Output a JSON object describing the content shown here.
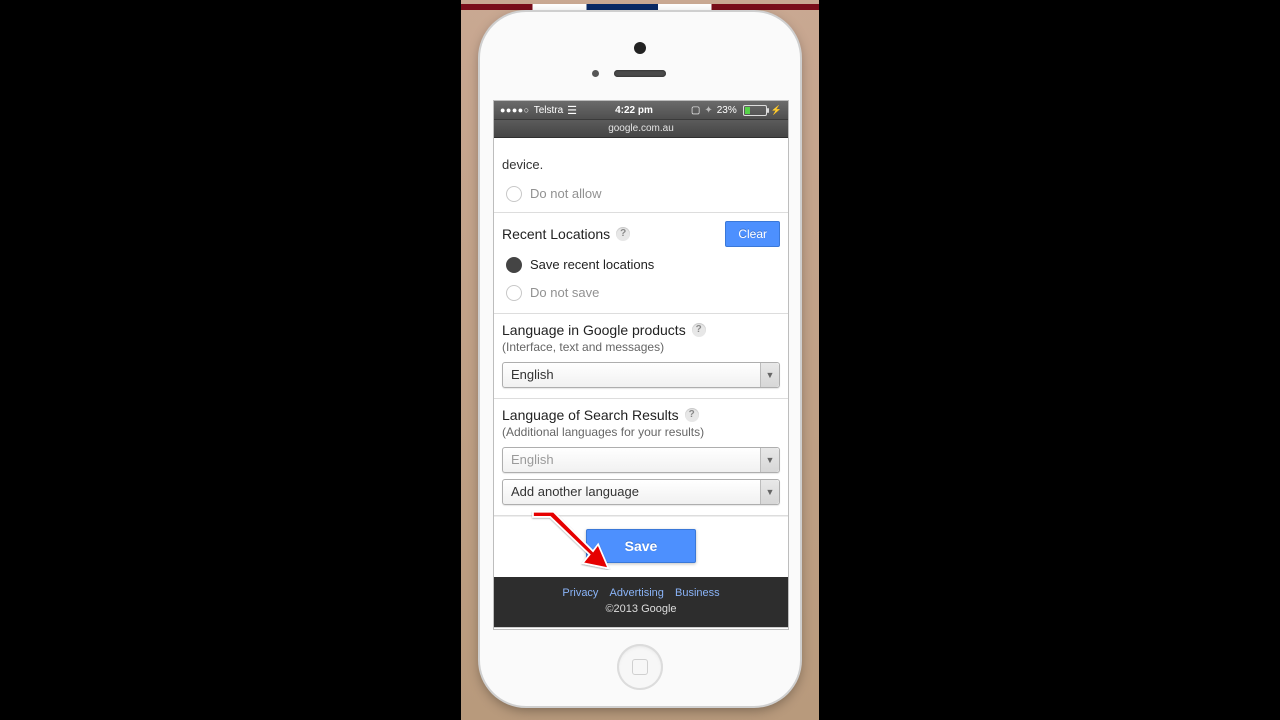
{
  "status": {
    "signal_dots": "●●●●○",
    "carrier": "Telstra",
    "time": "4:22 pm",
    "battery_pct": "23%"
  },
  "navbar": {
    "url": "google.com.au"
  },
  "location": {
    "truncated_text_tail": "device.",
    "do_not_allow": "Do not allow"
  },
  "recent": {
    "title": "Recent Locations",
    "clear": "Clear",
    "save": "Save recent locations",
    "dont_save": "Do not save"
  },
  "lang_products": {
    "title": "Language in Google products",
    "subtitle": "(Interface, text and messages)",
    "value": "English"
  },
  "lang_results": {
    "title": "Language of Search Results",
    "subtitle": "(Additional languages for your results)",
    "value": "English",
    "add_another": "Add another language"
  },
  "actions": {
    "save": "Save"
  },
  "footer": {
    "privacy": "Privacy",
    "advertising": "Advertising",
    "business": "Business",
    "copyright": "©2013 Google"
  }
}
